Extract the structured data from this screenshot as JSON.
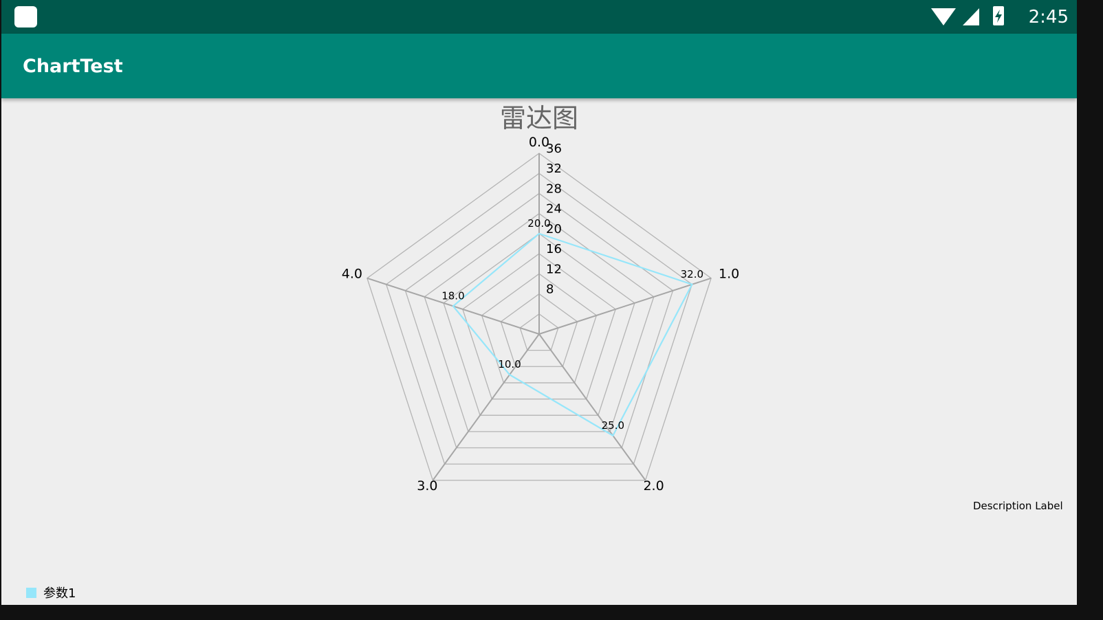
{
  "status_bar": {
    "time": "2:45",
    "icons": [
      "notification-icon",
      "wifi-icon",
      "signal-icon",
      "battery-charging-icon"
    ]
  },
  "app_bar": {
    "title": "ChartTest"
  },
  "chart_data": {
    "type": "radar",
    "title": "雷达图",
    "axes": [
      "0.0",
      "1.0",
      "2.0",
      "3.0",
      "4.0"
    ],
    "radial_ticks": [
      8,
      12,
      16,
      20,
      24,
      28,
      32,
      36
    ],
    "rlim": [
      0,
      36
    ],
    "series": [
      {
        "name": "参数1",
        "values": [
          20.0,
          32.0,
          25.0,
          10.0,
          18.0
        ],
        "value_labels": [
          "20.0",
          "32.0",
          "25.0",
          "10.0",
          "18.0"
        ],
        "color": "#96e6fa"
      }
    ],
    "description": "Description Label",
    "grid_color": "#b4b4b4",
    "web_color": "#a6a6a6",
    "legend_position": "bottom-left"
  }
}
